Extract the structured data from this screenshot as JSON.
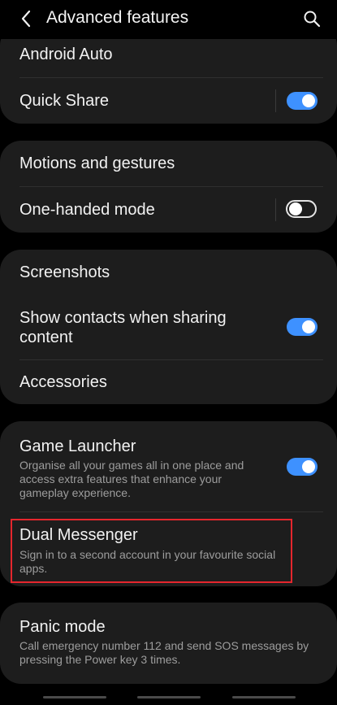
{
  "header": {
    "title": "Advanced features",
    "back_icon": "back-arrow-icon",
    "search_icon": "search-icon"
  },
  "colors": {
    "accent": "#3e91ff",
    "highlight": "#e5262d",
    "card": "#1d1d1d",
    "background": "#000000"
  },
  "group1": {
    "android_auto": "Android Auto",
    "quick_share": {
      "label": "Quick Share",
      "toggle": "on"
    }
  },
  "group2": {
    "motions": "Motions and gestures",
    "one_handed": {
      "label": "One-handed mode",
      "toggle": "off"
    }
  },
  "group3": {
    "screenshots": "Screenshots",
    "show_contacts": {
      "label_line1": "Show contacts when sharing",
      "label_line2": "content",
      "toggle": "on"
    },
    "accessories": "Accessories"
  },
  "group4": {
    "game_launcher": {
      "label": "Game Launcher",
      "sub_line1": "Organise all your games all in one place and",
      "sub_line2": "access extra features that enhance your",
      "sub_line3": "gameplay experience.",
      "toggle": "on"
    },
    "dual_messenger": {
      "label": "Dual Messenger",
      "sub_line1": "Sign in to a second account in your favourite social",
      "sub_line2": "apps."
    }
  },
  "group5": {
    "panic_mode": {
      "label": "Panic mode",
      "sub_line1": "Call emergency number 112 and send SOS messages by",
      "sub_line2": "pressing the Power key 3 times."
    }
  }
}
